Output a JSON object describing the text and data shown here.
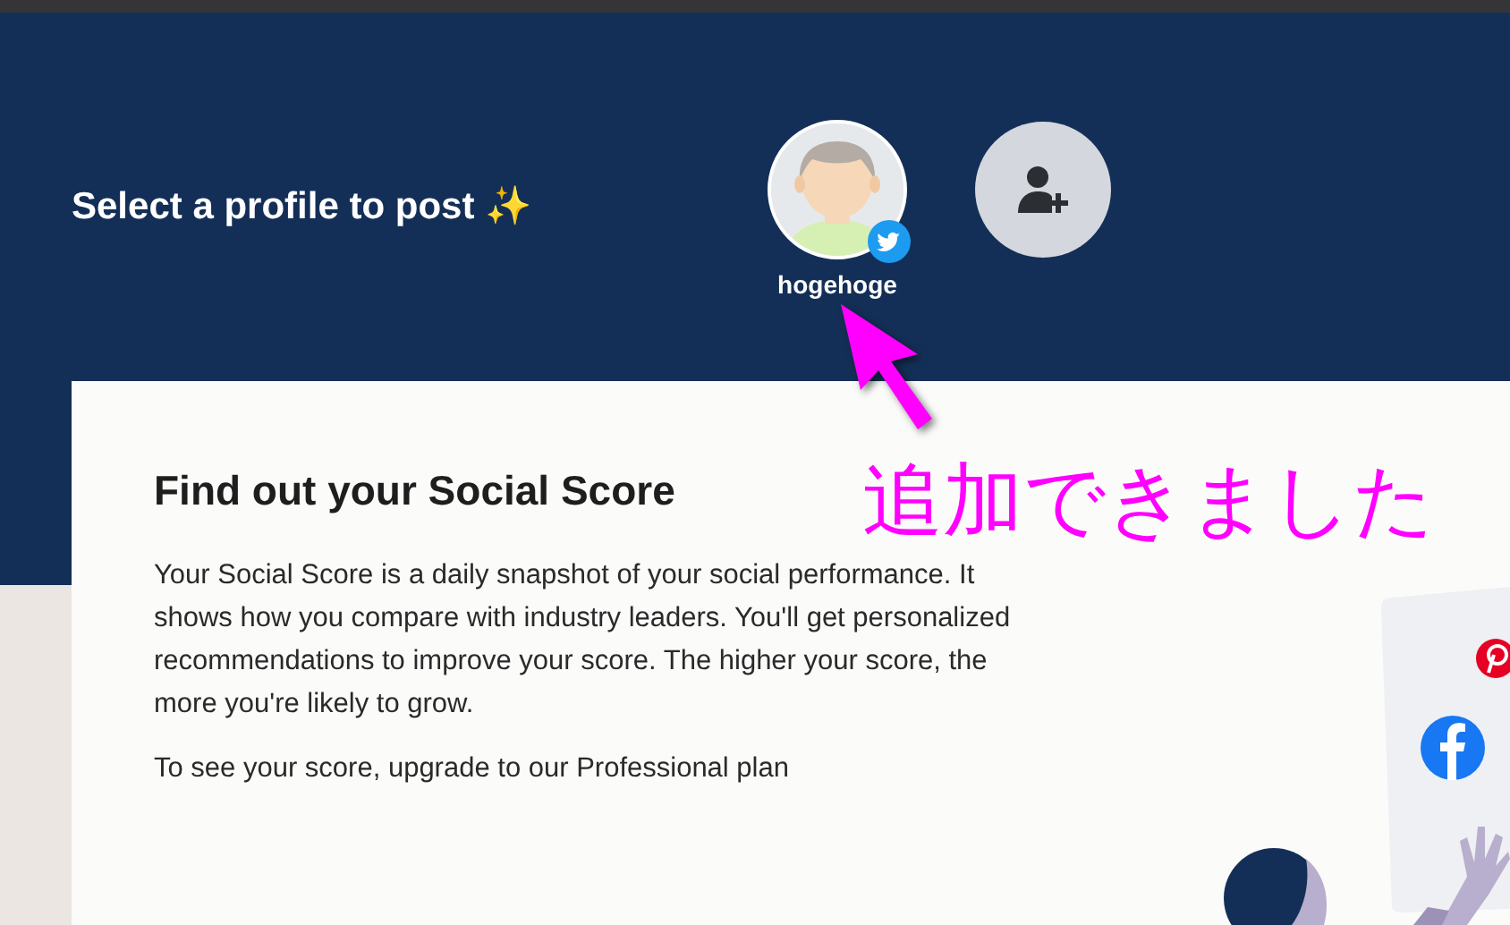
{
  "header": {
    "title": "Select a profile to post",
    "title_emoji": "✨",
    "profiles": [
      {
        "name": "hogehoge",
        "kind": "twitter"
      }
    ],
    "add_profile": {
      "kind": "button"
    }
  },
  "card": {
    "heading": "Find out your Social Score",
    "paragraphs": [
      "Your Social Score is a daily snapshot of your social performance. It shows how you compare with industry leaders. You'll get personalized recommendations to improve your score. The higher your score, the more you're likely to grow.",
      "To see your score, upgrade to our Professional plan"
    ]
  },
  "annotation": {
    "text": "追加できました"
  }
}
